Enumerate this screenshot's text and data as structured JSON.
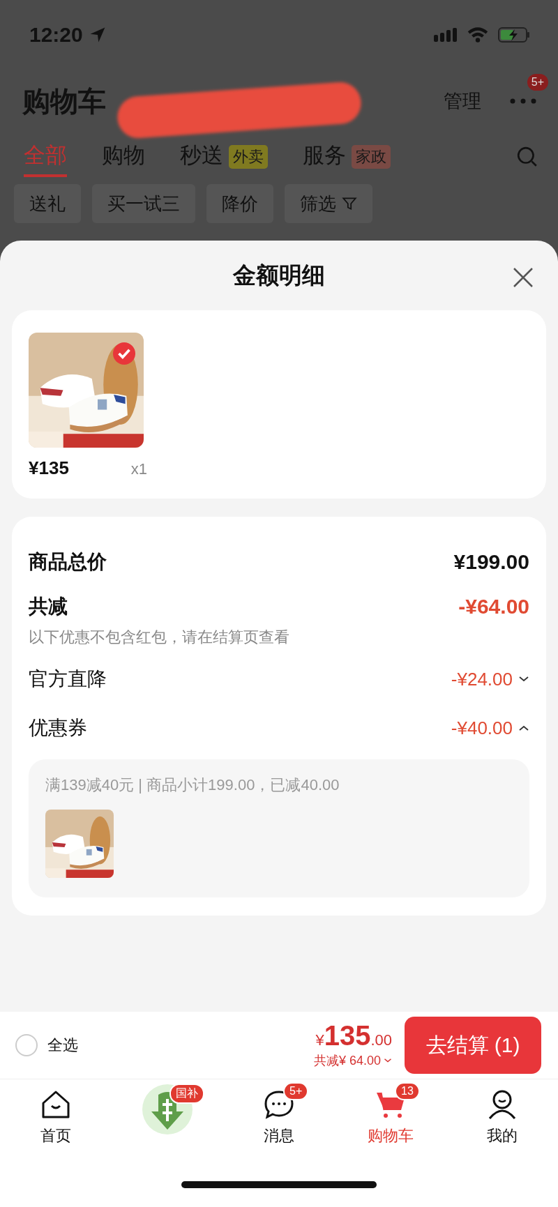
{
  "status_bar": {
    "time": "12:20"
  },
  "header": {
    "title": "购物车",
    "manage": "管理",
    "more_badge": "5+"
  },
  "tabs": [
    {
      "label": "全部",
      "selected": true
    },
    {
      "label": "购物",
      "selected": false
    },
    {
      "label": "秒送",
      "selected": false,
      "tag": "外卖",
      "color": "#807a20"
    },
    {
      "label": "服务",
      "selected": false,
      "tag": "家政",
      "color": "#7a4a44"
    }
  ],
  "chips": [
    {
      "label": "送礼",
      "kind": "plain"
    },
    {
      "label": "买一试三",
      "kind": "plain"
    },
    {
      "label": "降价",
      "kind": "plain"
    },
    {
      "label": "筛选",
      "kind": "filter"
    }
  ],
  "sheet": {
    "title": "金额明细",
    "items": [
      {
        "price": "¥135",
        "quantity": "x1",
        "selected": true
      }
    ],
    "breakdown": [
      {
        "kind": "total",
        "label": "商品总价",
        "amount": "¥199.00"
      },
      {
        "kind": "reduction",
        "label": "共减",
        "amount": "-¥64.00",
        "note": "以下优惠不包含红包，请在结算页查看"
      },
      {
        "kind": "discount",
        "label": "官方直降",
        "amount": "-¥24.00",
        "expanded": false
      },
      {
        "kind": "discount",
        "label": "优惠券",
        "amount": "-¥40.00",
        "expanded": true
      }
    ],
    "coupon_detail": {
      "text": "满139减40元 | 商品小计199.00，已减40.00"
    }
  },
  "checkout": {
    "select_all": {
      "label": "全选",
      "checked": false
    },
    "currency": "¥",
    "total_integer": "135",
    "total_decimal": ".00",
    "saving": "共减¥ 64.00",
    "button": "去结算 (1)"
  },
  "tab_bar": [
    {
      "kind": "home",
      "label": "首页",
      "selected": false
    },
    {
      "kind": "subsidy",
      "badge": "国补",
      "selected": false
    },
    {
      "kind": "messages",
      "label": "消息",
      "badge": "5+",
      "selected": false
    },
    {
      "kind": "cart",
      "label": "购物车",
      "badge": "13",
      "selected": true
    },
    {
      "kind": "profile",
      "label": "我的",
      "selected": false
    }
  ]
}
